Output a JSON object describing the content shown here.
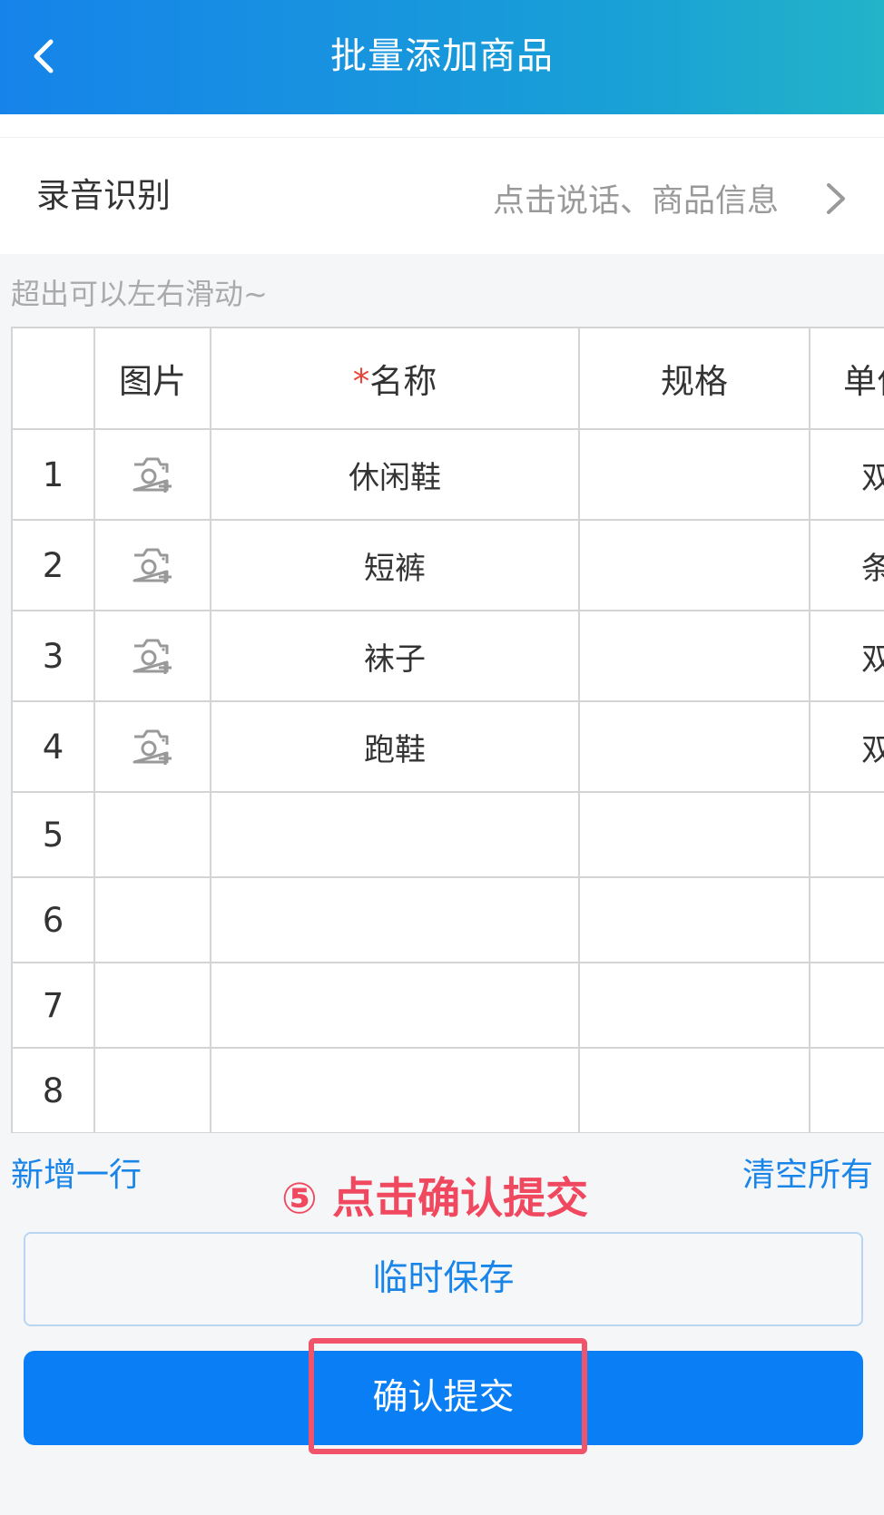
{
  "header": {
    "title": "批量添加商品",
    "back_icon": "chevron-left-icon"
  },
  "voice": {
    "label": "录音识别",
    "hint": "点击说话、商品信息"
  },
  "scroll_tip": "超出可以左右滑动~",
  "table": {
    "columns": {
      "image": "图片",
      "name_required_mark": "*",
      "name": "名称",
      "spec": "规格",
      "unit": "单位"
    },
    "rows": [
      {
        "index": "1",
        "name": "休闲鞋",
        "spec": "",
        "unit": "双",
        "has_photo_button": true
      },
      {
        "index": "2",
        "name": "短裤",
        "spec": "",
        "unit": "条",
        "has_photo_button": true
      },
      {
        "index": "3",
        "name": "袜子",
        "spec": "",
        "unit": "双",
        "has_photo_button": true
      },
      {
        "index": "4",
        "name": "跑鞋",
        "spec": "",
        "unit": "双",
        "has_photo_button": true
      },
      {
        "index": "5",
        "name": "",
        "spec": "",
        "unit": "",
        "has_photo_button": false
      },
      {
        "index": "6",
        "name": "",
        "spec": "",
        "unit": "",
        "has_photo_button": false
      },
      {
        "index": "7",
        "name": "",
        "spec": "",
        "unit": "",
        "has_photo_button": false
      },
      {
        "index": "8",
        "name": "",
        "spec": "",
        "unit": "",
        "has_photo_button": false
      }
    ]
  },
  "actions": {
    "add_row": "新增一行",
    "clear_all": "清空所有"
  },
  "annotation": "⑤ 点击确认提交",
  "buttons": {
    "save": "临时保存",
    "confirm": "确认提交"
  },
  "colors": {
    "accent": "#1a85e8",
    "primary_button": "#0a7ff5",
    "annotation": "#f0495f",
    "required": "#e5473a"
  }
}
